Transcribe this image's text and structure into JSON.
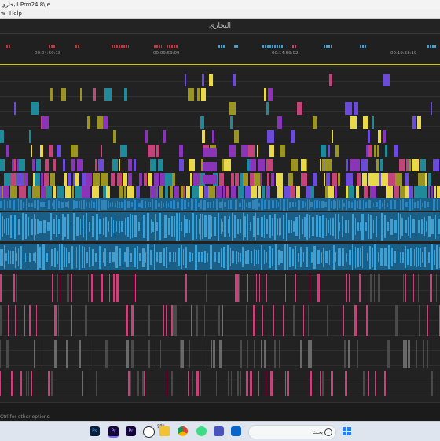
{
  "window": {
    "title": "البخاري Prm24.8\\ e"
  },
  "menu": {
    "items": [
      "w",
      "Help"
    ]
  },
  "sequence": {
    "name": "البخاري"
  },
  "ruler": {
    "timecodes": [
      "00:04:59:18",
      "00:09:59:09",
      "00:14:59:02",
      "00:19:58:19"
    ]
  },
  "status": {
    "hint": "Ctrl for other options."
  },
  "taskbar": {
    "apps": [
      "Ps",
      "Pr",
      "Pr",
      "chatgpt",
      "whatsapp",
      "notification",
      "file-explorer",
      "chrome",
      "android",
      "teams",
      "outlook",
      "folder",
      "photos"
    ],
    "search_label": "بحث",
    "badge": "99+"
  },
  "colors": {
    "teal": "#1f8a9a",
    "blue": "#3aa0d6",
    "purple": "#8a35b8",
    "violet": "#6b4bd8",
    "olive": "#9b9423",
    "pink": "#c2457a",
    "yellow": "#e8d84a",
    "red": "#c8323c"
  }
}
